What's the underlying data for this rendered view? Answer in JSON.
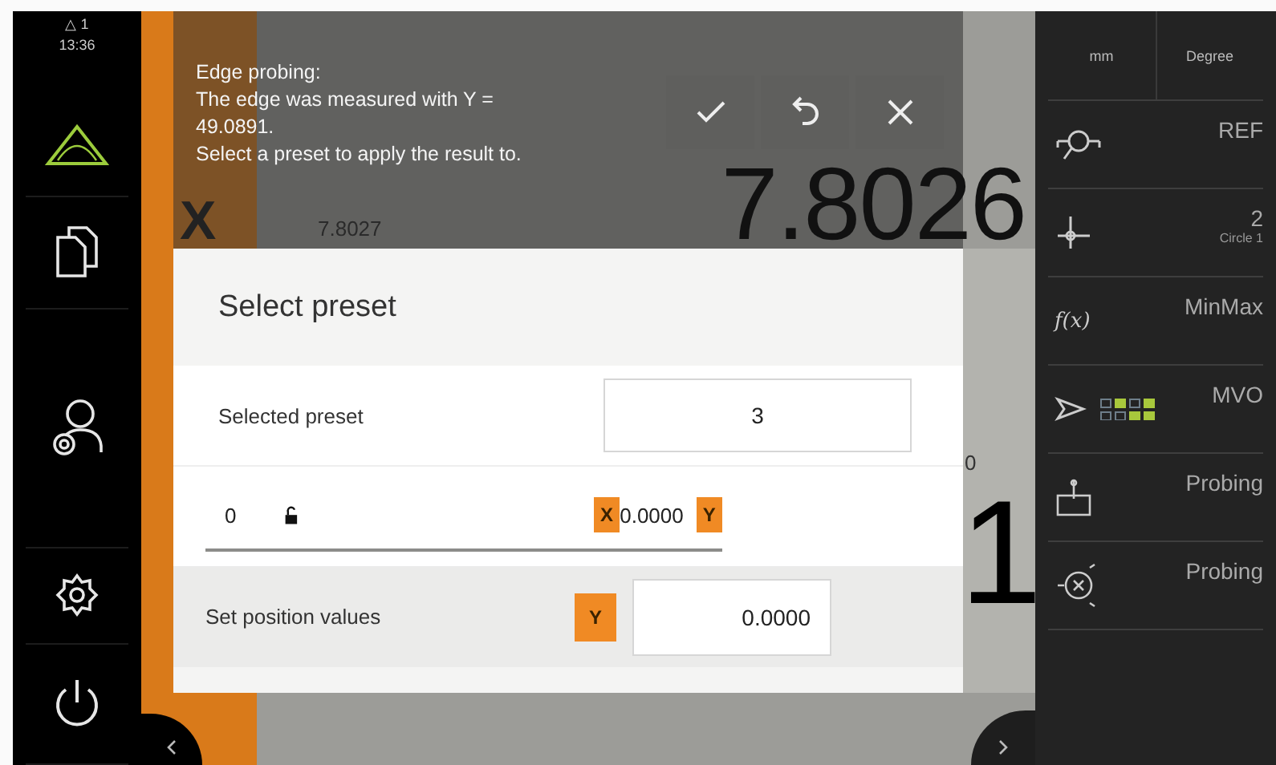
{
  "status": {
    "warnings": "△ 1",
    "time": "13:36"
  },
  "sidebar": {
    "items": [
      {
        "kind": "measure",
        "selected": true
      },
      {
        "kind": "files",
        "selected": false
      },
      {
        "kind": "user",
        "selected": false
      },
      {
        "kind": "settings",
        "selected": false
      },
      {
        "kind": "power",
        "selected": false
      }
    ]
  },
  "readout": {
    "axis_label": "X",
    "large_value": "7.8026",
    "small_value": "7.8027",
    "second_value": "1",
    "cut_value": "0"
  },
  "message": {
    "lines": [
      "Edge probing:",
      "The edge was measured with Y =",
      "49.0891.",
      "Select a preset to apply the result to."
    ]
  },
  "actions": [
    {
      "kind": "confirm"
    },
    {
      "kind": "undo"
    },
    {
      "kind": "cancel"
    }
  ],
  "dialog": {
    "title": "Select preset",
    "selected_preset": {
      "label": "Selected preset",
      "value": "3"
    },
    "preset_row": {
      "index": "0",
      "locked": false,
      "x_axis": "X",
      "x_value": "0.0000",
      "y_axis": "Y"
    },
    "set_position": {
      "label": "Set position values",
      "axis": "Y",
      "value": "0.0000"
    }
  },
  "units": [
    "mm",
    "Degree"
  ],
  "functions": [
    {
      "kind": "ref",
      "label": "REF"
    },
    {
      "kind": "preset",
      "label": "2",
      "sublabel": "Circle 1"
    },
    {
      "kind": "fx",
      "icon_text": "f(x)",
      "label": "MinMax"
    },
    {
      "kind": "mvo",
      "label": "MVO"
    },
    {
      "kind": "probe-edge",
      "label": "Probing"
    },
    {
      "kind": "probe-circle",
      "label": "Probing"
    }
  ]
}
